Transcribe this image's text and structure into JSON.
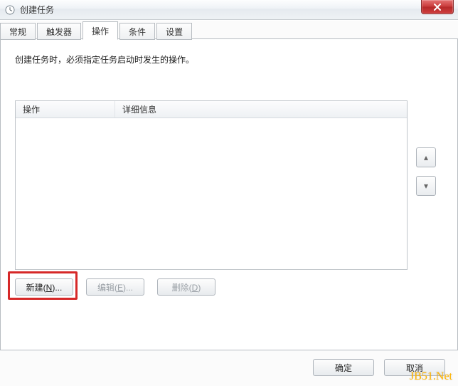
{
  "window": {
    "title": "创建任务"
  },
  "tabs": {
    "items": [
      {
        "label": "常规"
      },
      {
        "label": "触发器"
      },
      {
        "label": "操作"
      },
      {
        "label": "条件"
      },
      {
        "label": "设置"
      }
    ],
    "active_index": 2
  },
  "page": {
    "description": "创建任务时，必须指定任务启动时发生的操作。"
  },
  "table": {
    "columns": {
      "col1": "操作",
      "col2": "详细信息"
    },
    "rows": []
  },
  "action_buttons": {
    "new_prefix": "新建(",
    "new_key": "N",
    "new_suffix": ")...",
    "edit_prefix": "编辑(",
    "edit_key": "E",
    "edit_suffix": ")...",
    "delete_prefix": "删除(",
    "delete_key": "D",
    "delete_suffix": ")"
  },
  "side": {
    "up": "▴",
    "down": "▾"
  },
  "bottom": {
    "ok": "确定",
    "cancel": "取消"
  },
  "watermark": "JB51.Net"
}
